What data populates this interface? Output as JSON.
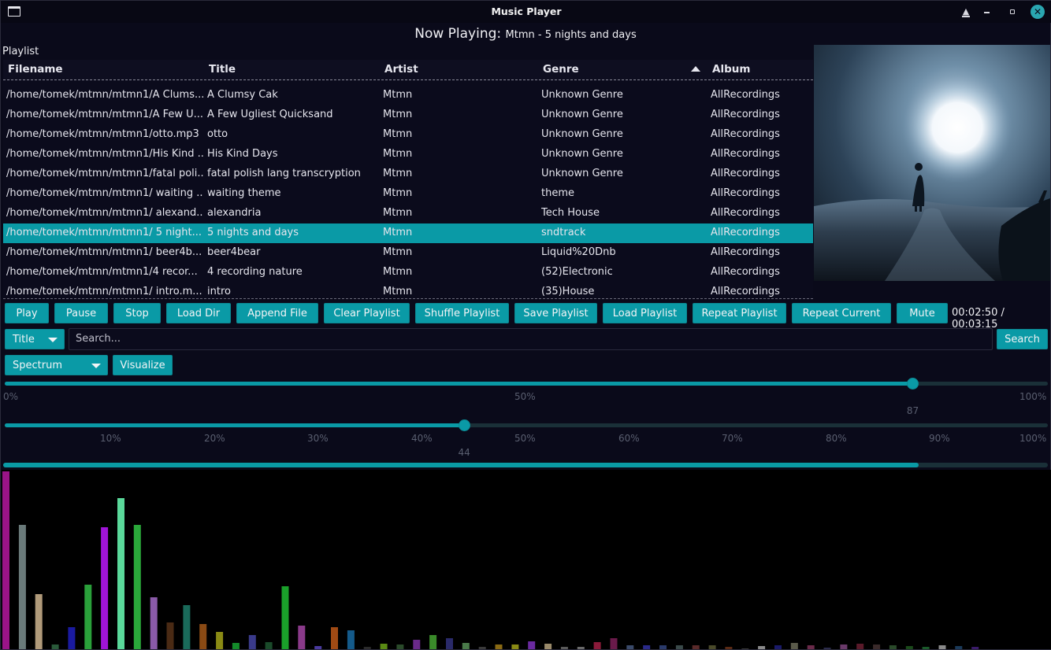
{
  "window": {
    "title": "Music Player",
    "controls": [
      "keep-above",
      "minimize",
      "maximize",
      "close"
    ]
  },
  "now_playing": {
    "prefix": "Now Playing:",
    "track": "Mtmn -  5  nights and days"
  },
  "playlist": {
    "label": "Playlist",
    "columns": [
      "Filename",
      "Title",
      "Artist",
      "Genre",
      "Album"
    ],
    "sort_column": "Genre",
    "sort_direction": "ascending",
    "partial_row": [
      "",
      "",
      "",
      "",
      ""
    ],
    "rows": [
      [
        "/home/tomek/mtmn/mtmn1/A Clums...",
        "A Clumsy Cak",
        "Mtmn",
        "Unknown Genre",
        "AllRecordings"
      ],
      [
        "/home/tomek/mtmn/mtmn1/A Few U...",
        "A Few Ugliest Quicksand",
        "Mtmn",
        "Unknown Genre",
        "AllRecordings"
      ],
      [
        "/home/tomek/mtmn/mtmn1/otto.mp3",
        "otto",
        "Mtmn",
        "Unknown Genre",
        "AllRecordings"
      ],
      [
        "/home/tomek/mtmn/mtmn1/His Kind ...",
        "His Kind Days",
        "Mtmn",
        "Unknown Genre",
        "AllRecordings"
      ],
      [
        "/home/tomek/mtmn/mtmn1/fatal poli...",
        "fatal polish lang transcryption",
        "Mtmn",
        "Unknown Genre",
        "AllRecordings"
      ],
      [
        "/home/tomek/mtmn/mtmn1/ waiting ...",
        " waiting theme",
        "Mtmn",
        "theme",
        "AllRecordings"
      ],
      [
        "/home/tomek/mtmn/mtmn1/ alexand...",
        " alexandria",
        "Mtmn",
        "Tech House",
        "AllRecordings"
      ],
      [
        "/home/tomek/mtmn/mtmn1/ 5  night...",
        " 5  nights and days",
        "Mtmn",
        "sndtrack",
        "AllRecordings"
      ],
      [
        "/home/tomek/mtmn/mtmn1/ beer4b...",
        " beer4bear",
        "Mtmn",
        "Liquid%20Dnb",
        "AllRecordings"
      ],
      [
        "/home/tomek/mtmn/mtmn1/4  recor...",
        "4  recording nature",
        "Mtmn",
        "(52)Electronic",
        "AllRecordings"
      ],
      [
        "/home/tomek/mtmn/mtmn1/ intro.m...",
        " intro",
        "Mtmn",
        "(35)House",
        "AllRecordings"
      ]
    ],
    "selected_index": 7
  },
  "buttons": {
    "play": "Play",
    "pause": "Pause",
    "stop": "Stop",
    "load_dir": "Load Dir",
    "append_file": "Append File",
    "clear_playlist": "Clear Playlist",
    "shuffle_playlist": "Shuffle Playlist",
    "save_playlist": "Save Playlist",
    "load_playlist": "Load Playlist",
    "repeat_playlist": "Repeat Playlist",
    "repeat_current": "Repeat Current",
    "mute": "Mute",
    "search": "Search",
    "visualize": "Visualize"
  },
  "time": {
    "display": "00:02:50 / 00:03:15"
  },
  "search": {
    "field_selected": "Title",
    "placeholder": "Search..."
  },
  "visualizer_select": {
    "selected": "Spectrum"
  },
  "position_slider": {
    "value": 87,
    "value_label": "87",
    "ticks": [
      "0%",
      "50%",
      "100%"
    ]
  },
  "volume_slider": {
    "value": 44,
    "value_label": "44",
    "ticks": [
      "10%",
      "20%",
      "30%",
      "40%",
      "50%",
      "60%",
      "70%",
      "80%",
      "90%",
      "100%"
    ]
  },
  "playback_progress": {
    "fraction": 0.876
  },
  "spectrum": {
    "max_value": 228,
    "bars": [
      {
        "value": 226,
        "color": "#9a1488"
      },
      {
        "value": 158,
        "color": "#6a7a7a"
      },
      {
        "value": 70,
        "color": "#b09a7a"
      },
      {
        "value": 6,
        "color": "#2a5a3a"
      },
      {
        "value": 28,
        "color": "#1a1aa0"
      },
      {
        "value": 82,
        "color": "#2aa03a"
      },
      {
        "value": 155,
        "color": "#a014d8"
      },
      {
        "value": 192,
        "color": "#5ad89a"
      },
      {
        "value": 158,
        "color": "#2aa83a"
      },
      {
        "value": 66,
        "color": "#8a5aa8"
      },
      {
        "value": 34,
        "color": "#4a2a14"
      },
      {
        "value": 56,
        "color": "#1a6a5a"
      },
      {
        "value": 32,
        "color": "#8a4a14"
      },
      {
        "value": 22,
        "color": "#8a8a14"
      },
      {
        "value": 8,
        "color": "#148a2a"
      },
      {
        "value": 18,
        "color": "#3a3a8a"
      },
      {
        "value": 9,
        "color": "#1a4a2a"
      },
      {
        "value": 80,
        "color": "#1aa02a"
      },
      {
        "value": 30,
        "color": "#8a3a8a"
      },
      {
        "value": 4,
        "color": "#4a3aa0"
      },
      {
        "value": 28,
        "color": "#a04a14"
      },
      {
        "value": 24,
        "color": "#145a8a"
      },
      {
        "value": 3,
        "color": "#2a2a2a"
      },
      {
        "value": 7,
        "color": "#5a8a14"
      },
      {
        "value": 6,
        "color": "#2a4a2a"
      },
      {
        "value": 12,
        "color": "#6a2a8a"
      },
      {
        "value": 18,
        "color": "#3a8a2a"
      },
      {
        "value": 14,
        "color": "#2a2a6a"
      },
      {
        "value": 8,
        "color": "#4a7a4a"
      },
      {
        "value": 3,
        "color": "#3a3a3a"
      },
      {
        "value": 6,
        "color": "#8a6a14"
      },
      {
        "value": 6,
        "color": "#8a8a14"
      },
      {
        "value": 10,
        "color": "#6a2aa0"
      },
      {
        "value": 7,
        "color": "#9a8a6a"
      },
      {
        "value": 3,
        "color": "#5a5a5a"
      },
      {
        "value": 3,
        "color": "#6a6a6a"
      },
      {
        "value": 9,
        "color": "#8a1a3a"
      },
      {
        "value": 14,
        "color": "#6a1a4a"
      },
      {
        "value": 5,
        "color": "#3a4a6a"
      },
      {
        "value": 5,
        "color": "#2a2a8a"
      },
      {
        "value": 5,
        "color": "#2a3a6a"
      },
      {
        "value": 5,
        "color": "#3a4a4a"
      },
      {
        "value": 5,
        "color": "#5a2a2a"
      },
      {
        "value": 5,
        "color": "#4a4a2a"
      },
      {
        "value": 3,
        "color": "#5a2a14"
      },
      {
        "value": 1,
        "color": "#3a3a3a"
      },
      {
        "value": 4,
        "color": "#8a8a8a"
      },
      {
        "value": 5,
        "color": "#1a1a6a"
      },
      {
        "value": 8,
        "color": "#5a5a4a"
      },
      {
        "value": 5,
        "color": "#6a2a4a"
      },
      {
        "value": 2,
        "color": "#2a2a4a"
      },
      {
        "value": 6,
        "color": "#6a3a6a"
      },
      {
        "value": 7,
        "color": "#5a1a2a"
      },
      {
        "value": 6,
        "color": "#3a2a2a"
      },
      {
        "value": 5,
        "color": "#2a4a2a"
      },
      {
        "value": 4,
        "color": "#1a4a1a"
      },
      {
        "value": 3,
        "color": "#1a5a2a"
      },
      {
        "value": 5,
        "color": "#8a8a8a"
      },
      {
        "value": 4,
        "color": "#1a3a5a"
      },
      {
        "value": 3,
        "color": "#3a1a6a"
      }
    ]
  }
}
